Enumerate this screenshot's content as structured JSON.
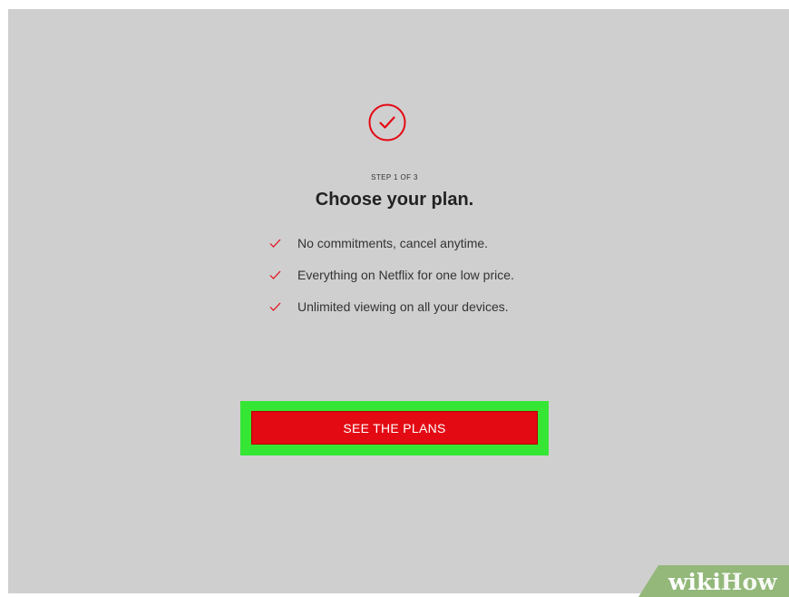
{
  "signup": {
    "icon": "check-circle-icon",
    "step_text": "STEP 1 OF 3",
    "title": "Choose your plan.",
    "benefits": [
      "No commitments, cancel anytime.",
      "Everything on Netflix for one low price.",
      "Unlimited viewing on all your devices."
    ],
    "cta_label": "SEE THE PLANS"
  },
  "watermark": {
    "wiki": "wiki",
    "how": "How"
  },
  "colors": {
    "background": "#cfcfcf",
    "accent": "#e30a13",
    "highlight": "#35e635",
    "watermark_bg": "#93b87a"
  }
}
